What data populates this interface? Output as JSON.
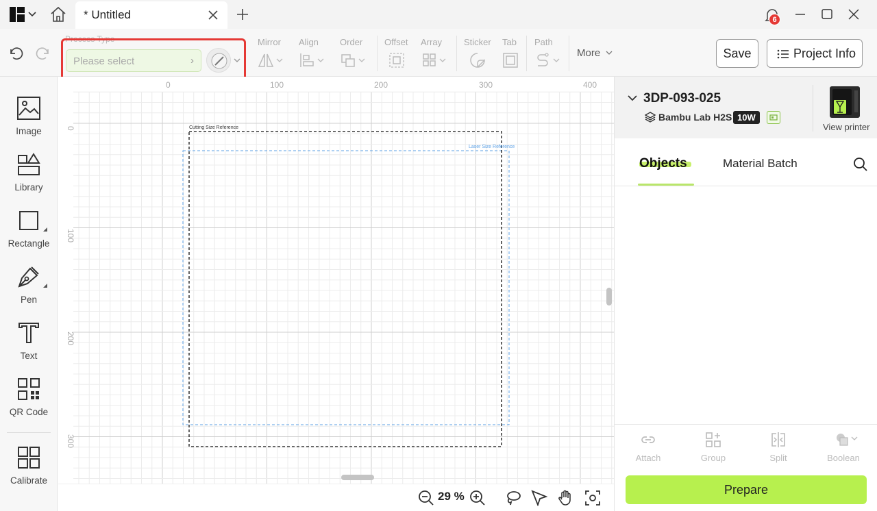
{
  "titlebar": {
    "tab_title": "* Untitled",
    "notification_count": "6"
  },
  "toolbar": {
    "process_type_label": "Process Type",
    "process_type_placeholder": "Please select",
    "groups": {
      "mirror": "Mirror",
      "align": "Align",
      "order": "Order",
      "offset": "Offset",
      "array": "Array",
      "sticker": "Sticker",
      "tab": "Tab",
      "path": "Path"
    },
    "more_label": "More",
    "save_label": "Save",
    "project_info_label": "Project Info"
  },
  "sidebar": {
    "items": [
      {
        "label": "Image",
        "icon": "image-icon"
      },
      {
        "label": "Library",
        "icon": "library-icon"
      },
      {
        "label": "Rectangle",
        "icon": "rectangle-icon"
      },
      {
        "label": "Pen",
        "icon": "pen-icon"
      },
      {
        "label": "Text",
        "icon": "text-icon"
      },
      {
        "label": "QR Code",
        "icon": "qr-code-icon"
      },
      {
        "label": "Calibrate",
        "icon": "calibrate-icon"
      }
    ]
  },
  "canvas": {
    "ruler_x": [
      "0",
      "100",
      "200",
      "300",
      "400"
    ],
    "ruler_y": [
      "0",
      "100",
      "200",
      "300"
    ],
    "cutting_reference_label": "Cutting Size Reference",
    "laser_reference_label": "Laser Size Reference",
    "zoom": "29 %"
  },
  "right_panel": {
    "printer_name": "3DP-093-025",
    "printer_model": "Bambu Lab H2S",
    "laser_power": "10W",
    "view_printer_label": "View printer",
    "tabs": [
      "Objects",
      "Material Batch"
    ],
    "actions": [
      "Attach",
      "Group",
      "Split",
      "Boolean"
    ],
    "prepare_label": "Prepare"
  },
  "colors": {
    "accent": "#b7f04e",
    "highlight": "#e53935",
    "laser_reference": "#5ea2e6"
  }
}
